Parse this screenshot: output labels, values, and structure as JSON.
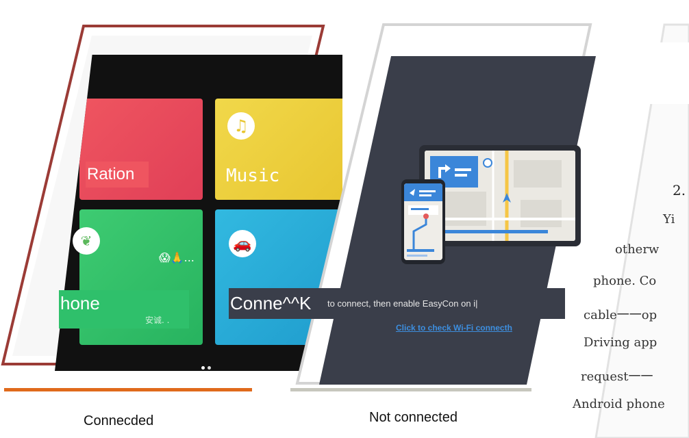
{
  "connected_panel": {
    "caption": "Connecded",
    "tiles": {
      "radio": "Ration",
      "music": "Music",
      "phone": "hone",
      "phone_sub": "安诚. .",
      "emoji": "😱🙏..."
    },
    "accent_underline": "#e06a1b"
  },
  "disconnected_panel": {
    "caption": "Not connected",
    "hint_big": "Conne^^K",
    "hint_small": "to connect, then enable EasyCon on i|",
    "wifi_link": "Click to check Wi-Fi connecth",
    "accent_underline": "#c7c7bd"
  },
  "document": {
    "heading": "2.",
    "lines": [
      "Yi",
      "otherw",
      "phone. Co",
      "cable一一op",
      "Driving app",
      "request一一",
      "Android phone"
    ]
  },
  "colors": {
    "radio_tile": "#ef5560",
    "music_tile": "#f1d84a",
    "phone_tile": "#2fc06b",
    "connect_tile": "#32b9e0",
    "screen_dark": "#3a3e4a",
    "link": "#3d8fe0"
  },
  "icons": [
    "music-note-icon",
    "car-icon",
    "leaf-icon",
    "navigation-arrow-icon",
    "location-pin-icon"
  ]
}
